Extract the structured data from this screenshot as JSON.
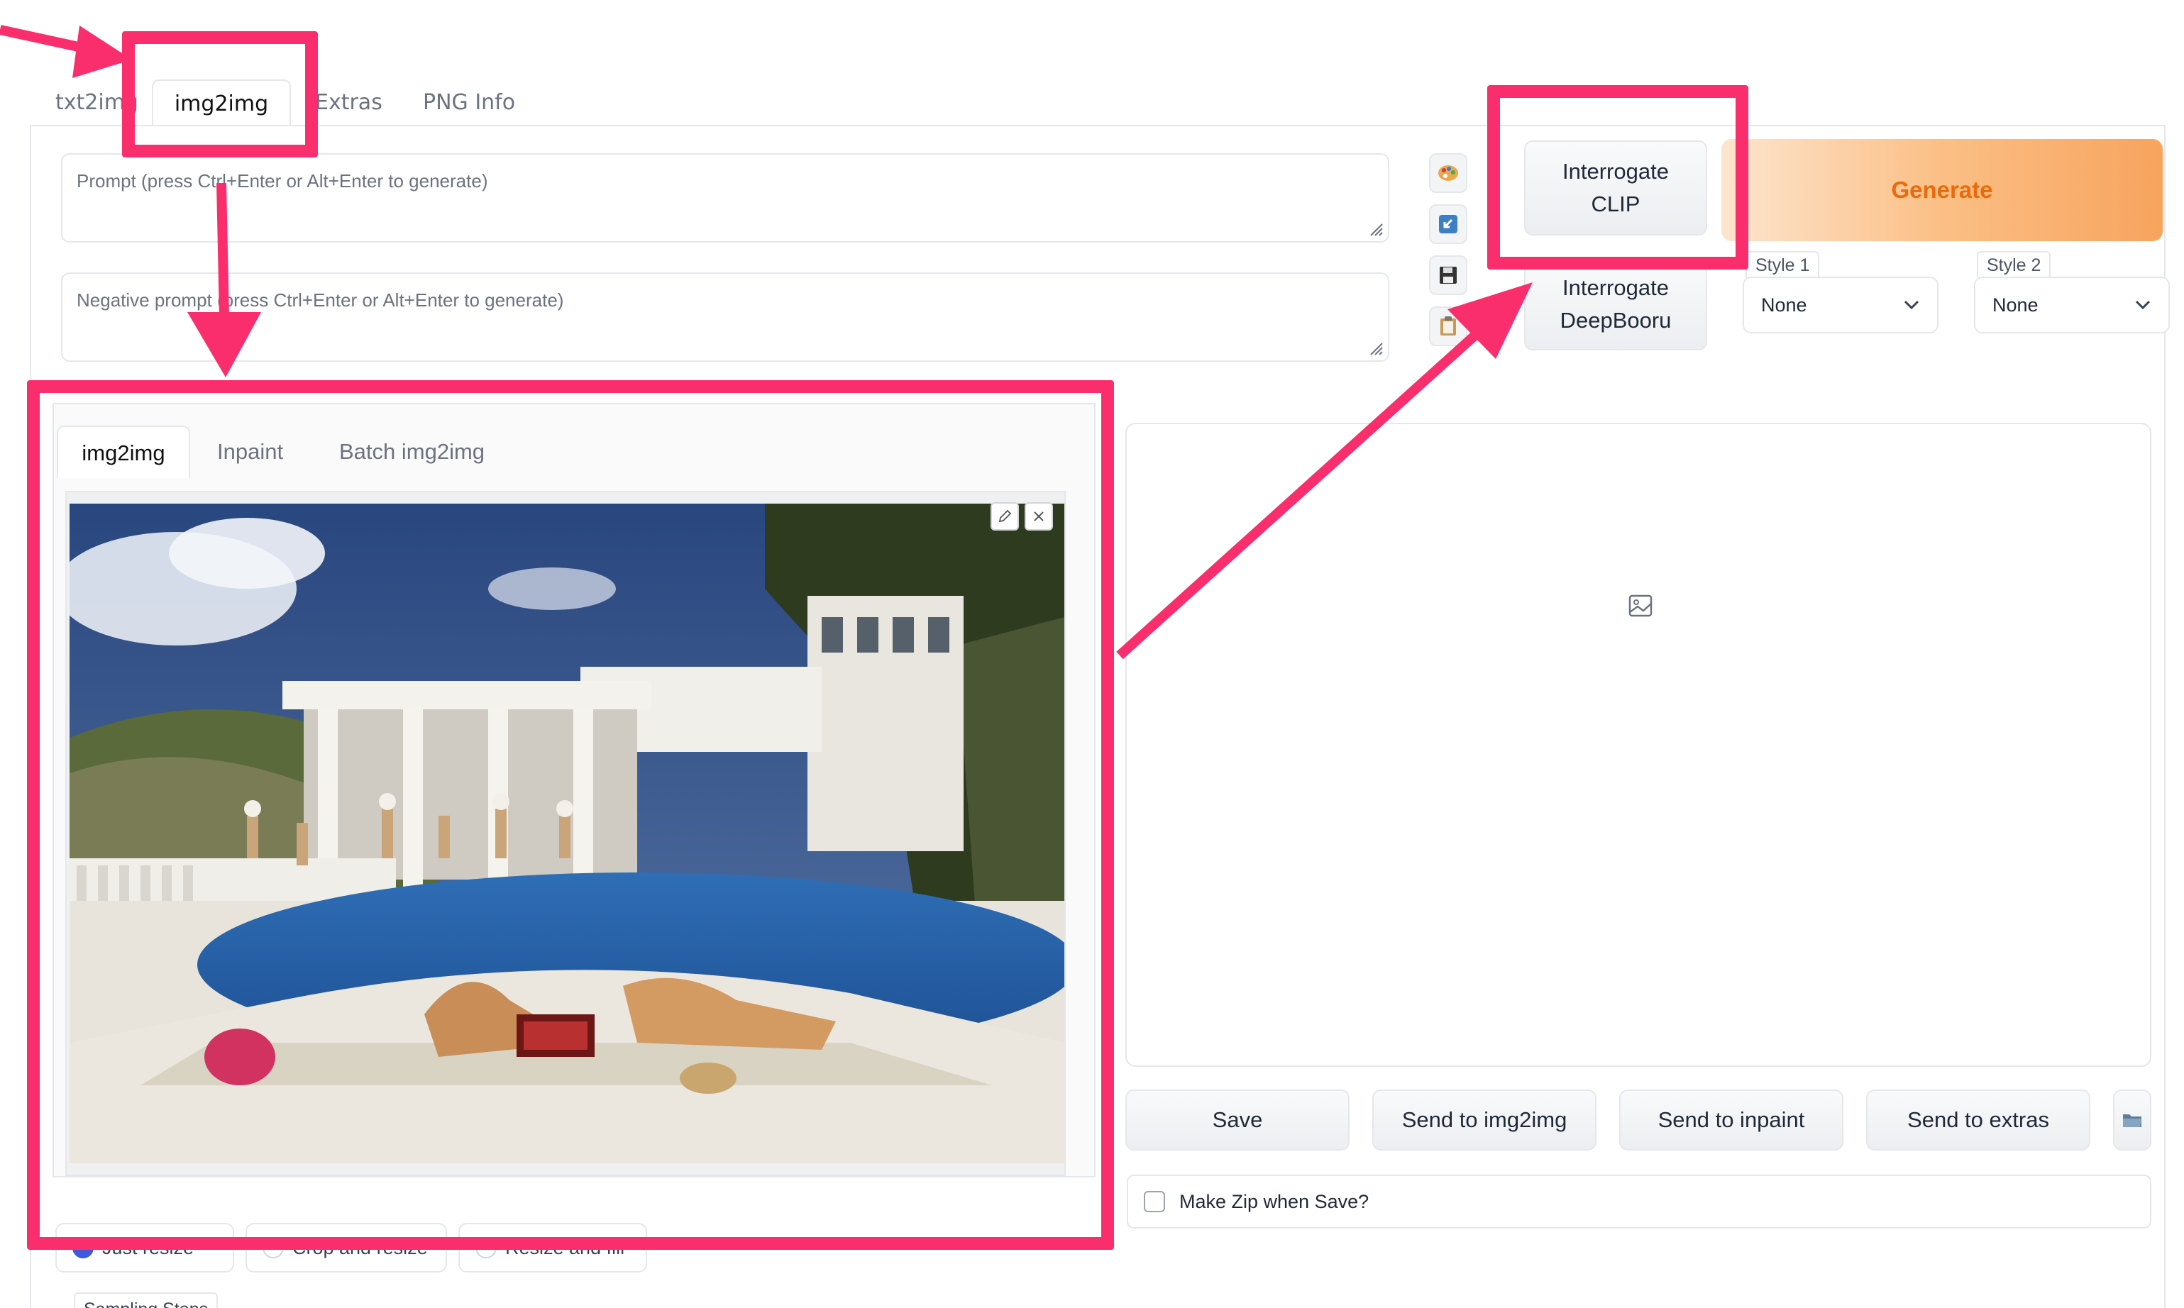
{
  "top_tabs": [
    "txt2img",
    "img2img",
    "Extras",
    "PNG Info"
  ],
  "prompt": {
    "placeholder": "Prompt (press Ctrl+Enter or Alt+Enter to generate)"
  },
  "negative_prompt": {
    "placeholder": "Negative prompt (press Ctrl+Enter or Alt+Enter to generate)"
  },
  "tools": {
    "interrogate_clip_line1": "Interrogate",
    "interrogate_clip_line2": "CLIP",
    "interrogate_deepbooru_line1": "Interrogate",
    "interrogate_deepbooru_line2": "DeepBooru",
    "generate": "Generate"
  },
  "styles": [
    {
      "label": "Style 1",
      "value": "None"
    },
    {
      "label": "Style 2",
      "value": "None"
    }
  ],
  "sub_tabs": [
    "img2img",
    "Inpaint",
    "Batch img2img"
  ],
  "resize_modes": [
    "Just resize",
    "Crop and resize",
    "Resize and fill"
  ],
  "sampling_label": "Sampling Steps",
  "output": {
    "save": "Save",
    "send_img2img": "Send to img2img",
    "send_inpaint": "Send to inpaint",
    "send_extras": "Send to extras",
    "zip_label": "Make Zip when Save?"
  },
  "colors": {
    "annotation": "#fb2e6d",
    "generate_text": "#ea6a0c",
    "generate_bg": "#fbbf85",
    "radio_selected": "#3b5bdb"
  },
  "icons": [
    "palette-icon",
    "paste-arrow-icon",
    "save-floppy-icon",
    "clipboard-icon",
    "image-placeholder-icon",
    "folder-icon",
    "pencil-icon",
    "close-icon",
    "chevron-down-icon",
    "resize-grip-icon"
  ]
}
